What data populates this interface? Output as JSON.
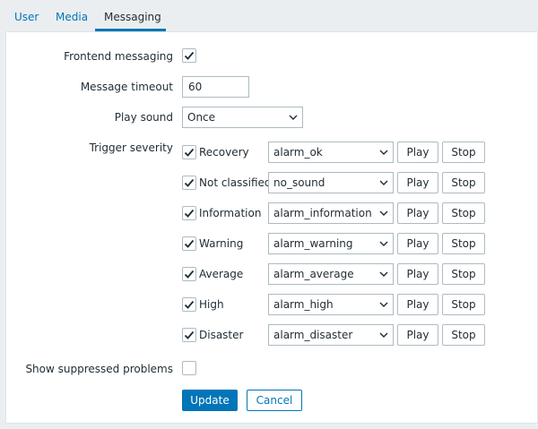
{
  "tabs": [
    {
      "label": "User"
    },
    {
      "label": "Media"
    },
    {
      "label": "Messaging"
    }
  ],
  "form": {
    "frontend_messaging": {
      "label": "Frontend messaging",
      "checked": true
    },
    "message_timeout": {
      "label": "Message timeout",
      "value": "60"
    },
    "play_sound": {
      "label": "Play sound",
      "value": "Once"
    },
    "trigger_severity": {
      "label": "Trigger severity"
    },
    "severities": [
      {
        "name": "Recovery",
        "checked": true,
        "sound": "alarm_ok"
      },
      {
        "name": "Not classified",
        "checked": true,
        "sound": "no_sound"
      },
      {
        "name": "Information",
        "checked": true,
        "sound": "alarm_information"
      },
      {
        "name": "Warning",
        "checked": true,
        "sound": "alarm_warning"
      },
      {
        "name": "Average",
        "checked": true,
        "sound": "alarm_average"
      },
      {
        "name": "High",
        "checked": true,
        "sound": "alarm_high"
      },
      {
        "name": "Disaster",
        "checked": true,
        "sound": "alarm_disaster"
      }
    ],
    "play_label": "Play",
    "stop_label": "Stop",
    "show_suppressed": {
      "label": "Show suppressed problems",
      "checked": false
    },
    "update_label": "Update",
    "cancel_label": "Cancel"
  },
  "colors": {
    "accent": "#0275b8",
    "background": "#ebeef0",
    "panel": "#ffffff",
    "border": "#acbbc2"
  }
}
